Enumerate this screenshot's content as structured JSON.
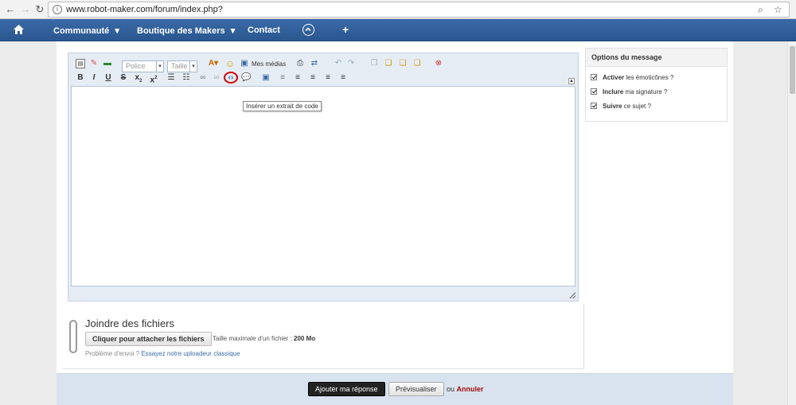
{
  "browser": {
    "url": "www.robot-maker.com/forum/index.php?",
    "info_glyph": "i"
  },
  "sitenav": {
    "items": [
      {
        "label": "Communauté",
        "arrow": "▾"
      },
      {
        "label": "Boutique des Makers",
        "arrow": "▾"
      },
      {
        "label": "Contact"
      }
    ],
    "plus": "+"
  },
  "editor": {
    "font_select": "Police",
    "size_select": "Taille",
    "media_label": "Mes médias",
    "tooltip": "Insérer un extrait de code",
    "format_buttons": {
      "bold": "B",
      "italic": "I",
      "underline": "U",
      "strike": "S",
      "subscript": "x",
      "superscript": "x"
    },
    "highlight_color": "#cc0000"
  },
  "attachments": {
    "title": "Joindre des fichiers",
    "button": "Cliquer pour attacher les fichiers",
    "max_label": "Taille maximale d'un fichier :",
    "max_value": "200 Mo",
    "problem_text": "Problème d'envoi ?",
    "problem_link": "Essayez notre uploadeur classique"
  },
  "options": {
    "title": "Options du message",
    "items": [
      {
        "strong": "Activer",
        "rest": " les émoticônes ?",
        "checked": true
      },
      {
        "strong": "Inclure",
        "rest": " ma signature ?",
        "checked": true
      },
      {
        "strong": "Suivre",
        "rest": " ce sujet ?",
        "checked": true
      }
    ]
  },
  "actions": {
    "submit": "Ajouter ma réponse",
    "preview": "Prévisualiser",
    "or": "ou",
    "cancel": "Annuler"
  },
  "colors": {
    "nav": "#2f5f9c",
    "submit_bg": "#d9e3ef",
    "cancel": "#a01010"
  }
}
